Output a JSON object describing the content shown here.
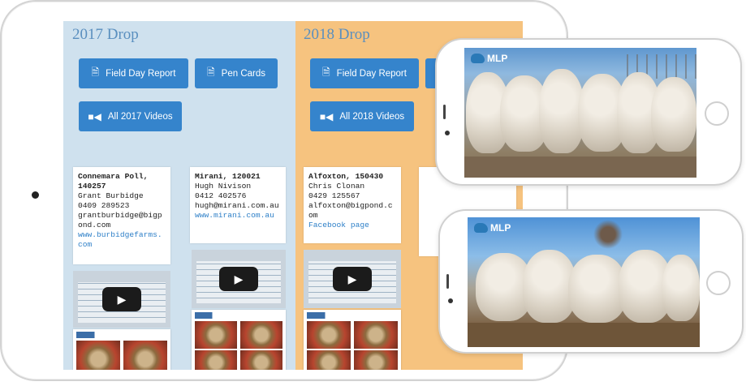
{
  "drops": [
    {
      "title": "2017 Drop",
      "buttons": [
        "Field Day Report",
        "Pen Cards"
      ],
      "videos_button": "All 2017 Videos",
      "cards": [
        {
          "name": "Connemara Poll, 140257",
          "contact": "Grant Burbidge",
          "phone": "0409 289523",
          "email": "grantburbidge@bigpond.com",
          "link": "www.burbidgefarms.com"
        },
        {
          "name": "Mirani, 120021",
          "contact": "Hugh Nivison",
          "phone": "0412 402576",
          "email": "hugh@mirani.com.au",
          "link": "www.mirani.com.au"
        }
      ]
    },
    {
      "title": "2018 Drop",
      "buttons": [
        "Field Day Report"
      ],
      "videos_button": "All 2018 Videos",
      "cards": [
        {
          "name": "Alfoxton, 150430",
          "contact": "Chris Clonan",
          "phone": "0429 125567",
          "email": "alfoxton@bigpond.com",
          "link": "Facebook page"
        },
        {
          "name": "",
          "contact": "",
          "phone": "",
          "email": "",
          "link": ""
        }
      ]
    }
  ],
  "phones": [
    {
      "brand": "MLP"
    },
    {
      "brand": "MLP"
    }
  ],
  "icons": {
    "report": "document-icon",
    "video": "video-camera-icon",
    "play": "play-icon"
  },
  "colors": {
    "col_2017": "#cfe1ee",
    "col_2018": "#f6c37f",
    "button": "#3584cc",
    "link": "#2f80c8",
    "title": "#5a8fbf"
  }
}
